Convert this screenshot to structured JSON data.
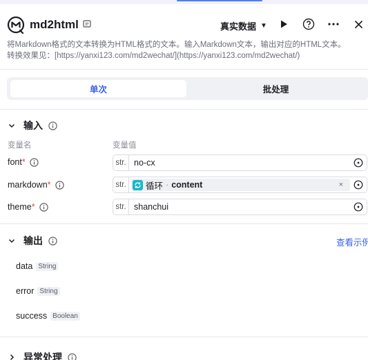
{
  "header": {
    "title": "md2html",
    "mode_label": "真实数据",
    "accent": "#3a62e0"
  },
  "description": {
    "line1": "将Markdown格式的文本转换为HTML格式的文本。输入Markdown文本，输出对应的HTML文本。",
    "line2": "转换效果见：[https://yanxi123.com/md2wechat/](https://yanxi123.com/md2wechat/)"
  },
  "tabs": [
    {
      "label": "单次",
      "active": true
    },
    {
      "label": "批处理",
      "active": false
    }
  ],
  "input_section": {
    "title": "输入",
    "col_name": "变量名",
    "col_value": "变量值",
    "rows": [
      {
        "name": "font",
        "type": "str.",
        "value": "no-cx"
      },
      {
        "name": "markdown",
        "type": "str.",
        "loop_label": "循环",
        "separator": "·",
        "ref_var": "content",
        "clear": "×"
      },
      {
        "name": "theme",
        "type": "str.",
        "value": "shanchui"
      }
    ]
  },
  "output_section": {
    "title": "输出",
    "example_link": "查看示例",
    "items": [
      {
        "name": "data",
        "type": "String"
      },
      {
        "name": "error",
        "type": "String"
      },
      {
        "name": "success",
        "type": "Boolean"
      }
    ]
  },
  "exception_section": {
    "title": "异常处理"
  },
  "required_mark": "*"
}
